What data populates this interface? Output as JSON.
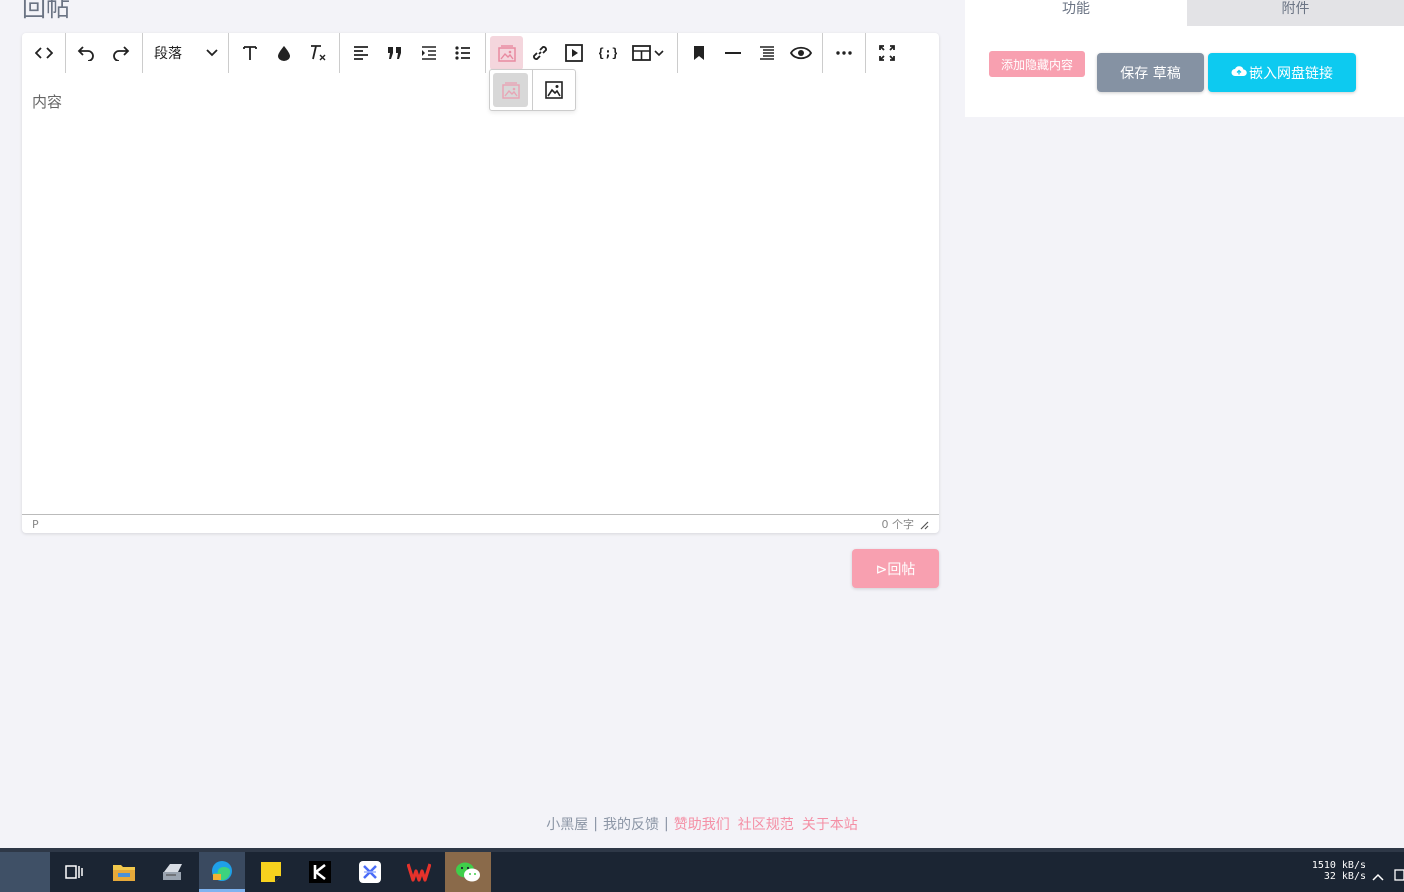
{
  "page": {
    "title": "回帖"
  },
  "editor": {
    "format_select": "段落",
    "placeholder": "内容",
    "status_path": "P",
    "word_count": "0 个字"
  },
  "reply_button": {
    "label": "⊳回帖"
  },
  "side_panel": {
    "tabs": [
      "功能",
      "附件"
    ],
    "hidden_content_button": "添加隐藏内容",
    "save_draft_button": "保存 草稿",
    "cloud_link_button": "嵌入网盘链接"
  },
  "footer": {
    "links": [
      {
        "label": "小黑屋",
        "color": "gray"
      },
      {
        "label": "我的反馈",
        "color": "gray"
      },
      {
        "label": "赞助我们",
        "color": "pink"
      },
      {
        "label": "社区规范",
        "color": "pink"
      },
      {
        "label": "关于本站",
        "color": "pink"
      }
    ],
    "separator": "|"
  },
  "taskbar": {
    "net_up": "1510 kB/s",
    "net_down": "32 kB/s",
    "apps": [
      "task-view",
      "file-explorer",
      "printer-app",
      "edge-browser",
      "sticky-notes",
      "k-app",
      "x-app",
      "wps-office",
      "wechat"
    ]
  },
  "colors": {
    "accent_pink": "#f8a0b0",
    "draft_gray": "#8592a3",
    "cloud_cyan": "#0dcaf0",
    "taskbar": "#1b2533"
  }
}
